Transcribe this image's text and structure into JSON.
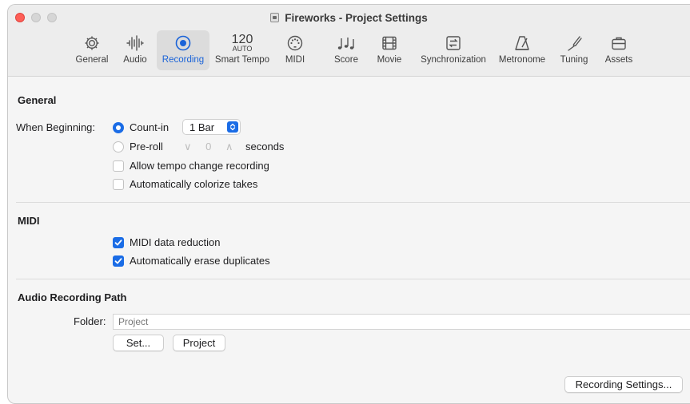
{
  "window": {
    "title": "Fireworks - Project Settings"
  },
  "toolbar": {
    "items": [
      {
        "label": "General",
        "icon": "gear-icon"
      },
      {
        "label": "Audio",
        "icon": "waveform-icon"
      },
      {
        "label": "Recording",
        "icon": "record-icon",
        "active": true
      },
      {
        "label": "Smart Tempo",
        "icon_top": "120",
        "icon_bottom": "AUTO"
      },
      {
        "label": "MIDI",
        "icon": "midi-port-icon"
      },
      {
        "label": "Score",
        "icon": "music-notes-icon"
      },
      {
        "label": "Movie",
        "icon": "film-icon"
      },
      {
        "label": "Synchronization",
        "icon": "sync-icon"
      },
      {
        "label": "Metronome",
        "icon": "metronome-icon"
      },
      {
        "label": "Tuning",
        "icon": "tuning-fork-icon"
      },
      {
        "label": "Assets",
        "icon": "briefcase-icon"
      }
    ]
  },
  "general": {
    "title": "General",
    "when_beginning_label": "When Beginning:",
    "count_in": {
      "label": "Count-in",
      "selected": true,
      "value": "1 Bar"
    },
    "pre_roll": {
      "label": "Pre-roll",
      "selected": false,
      "value": "0",
      "unit": "seconds",
      "down": "∨",
      "up": "∧"
    },
    "allow_tempo_change": {
      "label": "Allow tempo change recording",
      "checked": false
    },
    "auto_colorize": {
      "label": "Automatically colorize takes",
      "checked": false
    }
  },
  "midi": {
    "title": "MIDI",
    "data_reduction": {
      "label": "MIDI data reduction",
      "checked": true
    },
    "erase_duplicates": {
      "label": "Automatically erase duplicates",
      "checked": true
    }
  },
  "audio_path": {
    "title": "Audio Recording Path",
    "folder_label": "Folder:",
    "folder_placeholder": "Project",
    "set_button": "Set...",
    "project_button": "Project"
  },
  "footer": {
    "recording_settings_button": "Recording Settings..."
  },
  "colors": {
    "accent": "#1a6ce6",
    "close": "#fe5f57"
  }
}
